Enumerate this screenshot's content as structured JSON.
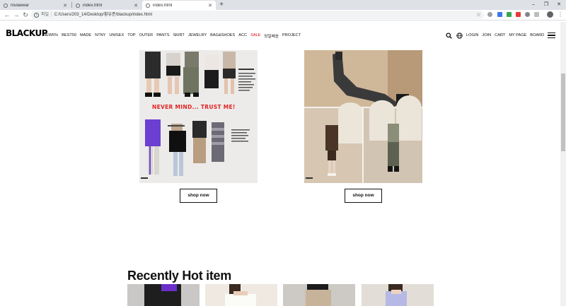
{
  "browser": {
    "tabs": [
      {
        "label": "mulawear",
        "active": false
      },
      {
        "label": "index.html",
        "active": false
      },
      {
        "label": "index.html",
        "active": true
      }
    ],
    "address": {
      "scheme_label": "파일",
      "url": "C:/Users/203_14/Desktop/황유준/blackup/index.html"
    }
  },
  "header": {
    "logo": "BLACKUP",
    "nav": [
      "NEW5%",
      "BEST50",
      "MADE",
      "NTNY",
      "UNISEX",
      "TOP",
      "OUTER",
      "PANTS",
      "SKIRT",
      "JEWELRY",
      "BAG&SHOES",
      "ACC",
      "SALE",
      "당일배송",
      "PROJECT"
    ],
    "util": [
      "LOGIN",
      "JOIN",
      "CART",
      "MY PAGE",
      "BOARD"
    ]
  },
  "promos": [
    {
      "headline": "NEVER MIND... TRUST ME!",
      "cta": "shop now"
    },
    {
      "cta": "shop now"
    }
  ],
  "hot": {
    "title": "Recently Hot item"
  },
  "colors": {
    "sale": "#e60012",
    "text": "#111111",
    "tabbar": "#dee1e6"
  }
}
